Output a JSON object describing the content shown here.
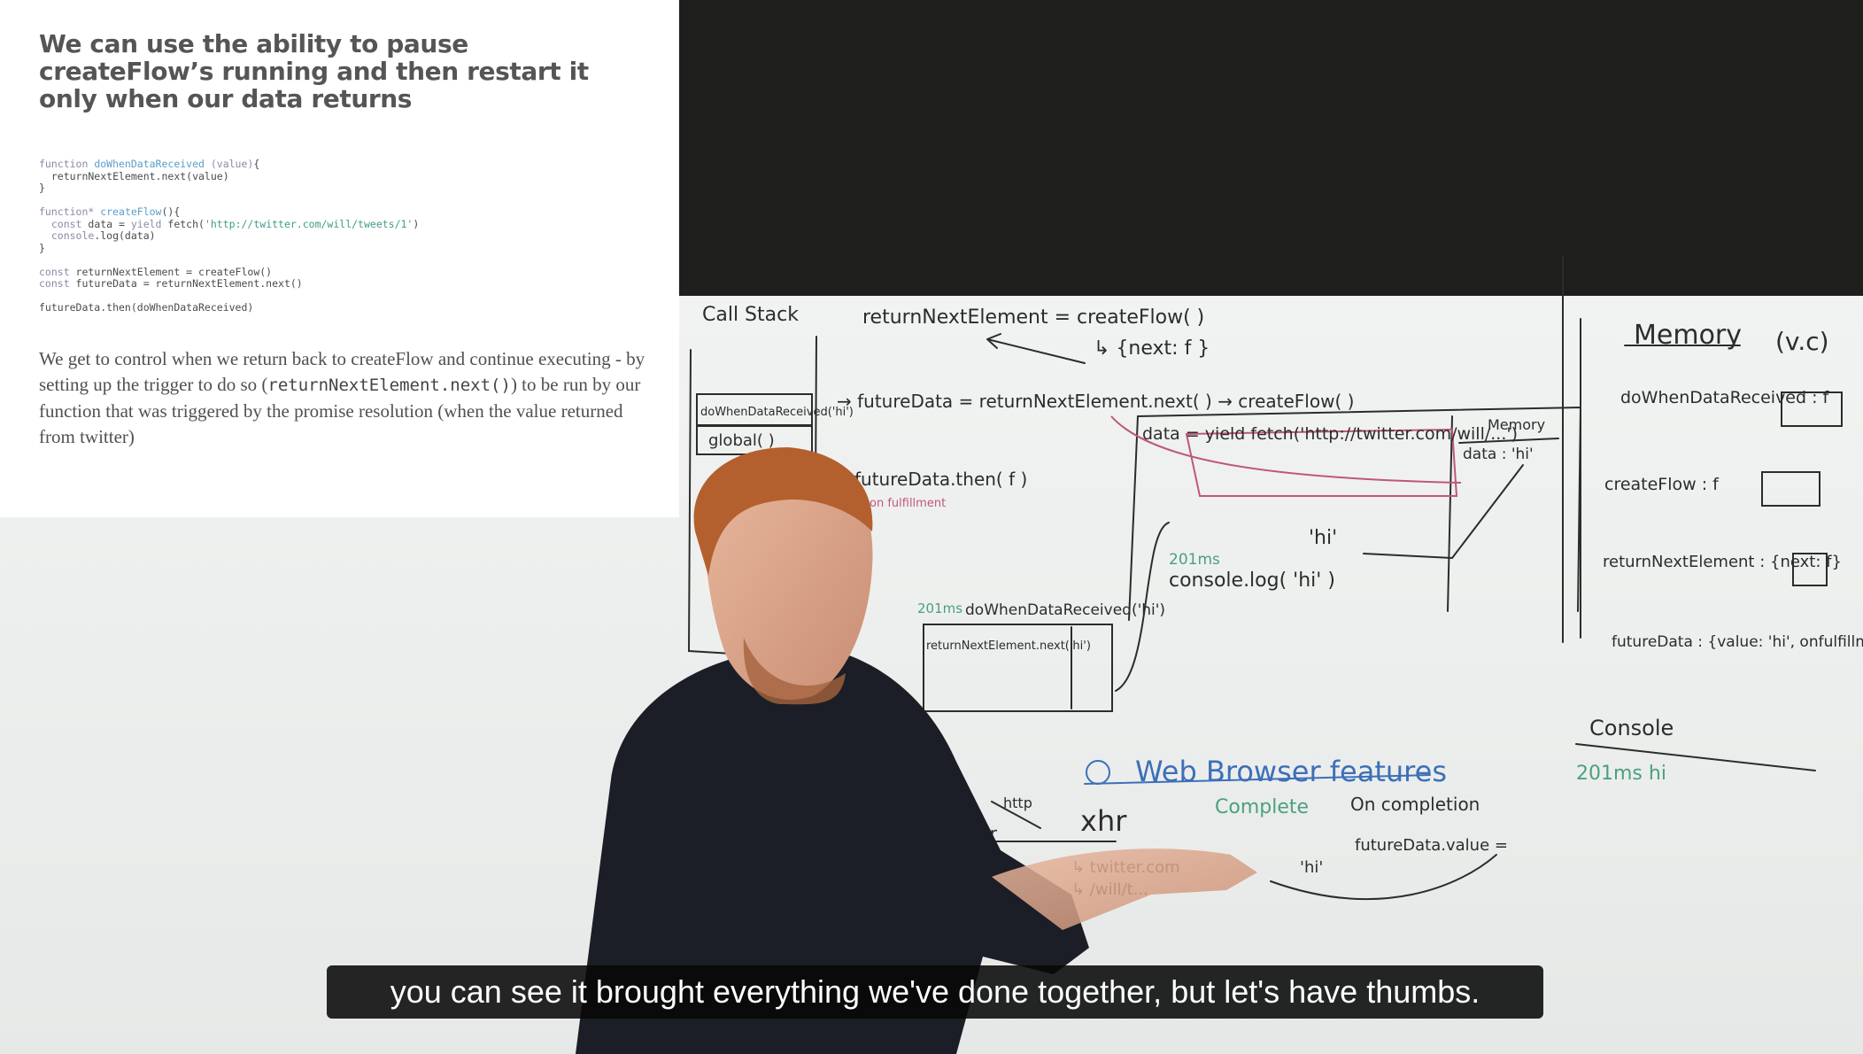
{
  "slide": {
    "title": "We can use the ability to pause createFlow’s running and then restart it only when our data returns",
    "code": [
      {
        "kind": "line",
        "parts": [
          {
            "c": "c-kw",
            "t": "function "
          },
          {
            "c": "c-fn",
            "t": "doWhenDataReceived"
          },
          {
            "c": "c-kw",
            "t": " (value)"
          },
          {
            "c": "",
            "t": "{"
          }
        ]
      },
      {
        "kind": "line",
        "parts": [
          {
            "c": "",
            "t": "  returnNextElement.next(value)"
          }
        ]
      },
      {
        "kind": "line",
        "parts": [
          {
            "c": "",
            "t": "}"
          }
        ]
      },
      {
        "kind": "gap"
      },
      {
        "kind": "line",
        "parts": [
          {
            "c": "c-kw",
            "t": "function* "
          },
          {
            "c": "c-fn",
            "t": "createFlow"
          },
          {
            "c": "",
            "t": "(){"
          }
        ]
      },
      {
        "kind": "line",
        "parts": [
          {
            "c": "c-kw",
            "t": "  const "
          },
          {
            "c": "",
            "t": "data = "
          },
          {
            "c": "c-kw",
            "t": "yield "
          },
          {
            "c": "",
            "t": "fetch("
          },
          {
            "c": "c-str",
            "t": "'http://twitter.com/will/tweets/1'"
          },
          {
            "c": "",
            "t": ")"
          }
        ]
      },
      {
        "kind": "line",
        "parts": [
          {
            "c": "c-kw",
            "t": "  console"
          },
          {
            "c": "",
            "t": ".log(data)"
          }
        ]
      },
      {
        "kind": "line",
        "parts": [
          {
            "c": "",
            "t": "}"
          }
        ]
      },
      {
        "kind": "gap"
      },
      {
        "kind": "line",
        "parts": [
          {
            "c": "c-kw",
            "t": "const "
          },
          {
            "c": "",
            "t": "returnNextElement = createFlow()"
          }
        ]
      },
      {
        "kind": "line",
        "parts": [
          {
            "c": "c-kw",
            "t": "const "
          },
          {
            "c": "",
            "t": "futureData = returnNextElement.next()"
          }
        ]
      },
      {
        "kind": "gap"
      },
      {
        "kind": "line",
        "parts": [
          {
            "c": "",
            "t": "futureData.then(doWhenDataReceived)"
          }
        ]
      }
    ],
    "body": {
      "before": "We get to control when we return back to createFlow and continue executing - by setting up the trigger to do so (",
      "code": "returnNextElement.next()",
      "after": ") to be run by our function that was triggered by the promise resolution (when the value returned from twitter)"
    }
  },
  "whiteboard": {
    "call_stack_title": "Call Stack",
    "memory_title": "Memory",
    "memory_sub": "(v.c)",
    "rne_line": "returnNextElement = createFlow( )",
    "next_obj": "↳ {next: f }",
    "futuredata_line": "→ futureData = returnNextElement.next( ) → createFlow( )",
    "data_line": "data = yield fetch('http://twitter.com/will/...')",
    "cs_frame1": "doWhenDataReceived('hi')",
    "cs_frame2": "global( )",
    "then_line": "futureData.then( f )",
    "on_fulfillment": "on fulfillment",
    "hi_label": "'hi'",
    "time1": "201ms",
    "console_log": "console.log( 'hi' )",
    "time2": "201ms",
    "dwdr_call": "doWhenDataReceived('hi')",
    "rne_next_call": "returnNextElement.next('hi')",
    "local_memory": "Memory",
    "local_data": "data : 'hi'",
    "mem_dwdr": "doWhenDataReceived : f",
    "mem_createflow": "createFlow : f",
    "mem_rne": "returnNextElement : {next: f}",
    "mem_futuredata": "futureData : {value: 'hi', onfulfillment: [f]}",
    "console_title": "Console",
    "console_out": "201ms  hi",
    "web_browser": "Web Browser features",
    "xhr": "xhr",
    "complete": "Complete",
    "on_completion": "On completion",
    "fd_value": "futureData.value =",
    "http": "http",
    "twitter": "twitter",
    "twitter_url": "↳ twitter.com",
    "path": "↳ /will/t...",
    "hi2": "'hi'"
  },
  "caption": "you can see it brought everything we've done together, but let's have thumbs.",
  "colors": {
    "marker_black": "#2c2c2c",
    "marker_pink": "#c0567a",
    "marker_blue": "#3d6fb8",
    "marker_green": "#4aa17e"
  }
}
